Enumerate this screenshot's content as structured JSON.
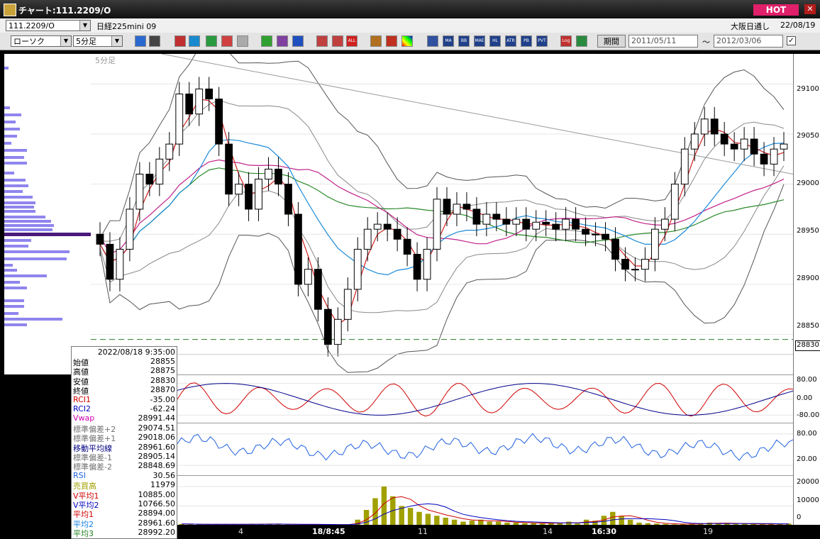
{
  "window": {
    "title": "チャート:111.2209/O",
    "hot_label": "HOT",
    "close_label": "✕"
  },
  "header": {
    "symbol": "111.2209/O",
    "name": "日経225mini 09",
    "market": "大阪日通し",
    "date": "22/08/19"
  },
  "toolbar": {
    "chart_type": "ローソク",
    "interval": "5分足",
    "period_button": "期間",
    "date_from": "2011/05/11",
    "date_to": "2012/03/06",
    "range_sep": "〜",
    "icons": [
      "zoom-icon",
      "cursor-icon",
      "draw-icon",
      "analyze-icon",
      "chart-icon",
      "trend-icon",
      "info-icon",
      "pen-icon",
      "arrow-icon",
      "return-icon",
      "split-icon",
      "gap-icon",
      "all-icon",
      "gear-icon",
      "tools-icon",
      "color-icon",
      "bars-icon",
      "ma-icon",
      "bb-icon",
      "mae-icon",
      "hl-icon",
      "atr-icon",
      "pb-icon",
      "pvt-icon",
      "log-icon",
      "exit-icon"
    ],
    "icon_texts": [
      "MA",
      "BB",
      "MAE",
      "HL",
      "ATR",
      "PB",
      "PVT",
      "Log",
      "ALL"
    ],
    "checkbox_mark": "✓"
  },
  "main_panel": {
    "interval_label": "5分足",
    "price_flag": "28830",
    "y_ticks": [
      "29100",
      "29050",
      "29000",
      "28950",
      "28900",
      "28850"
    ]
  },
  "sub_panels": {
    "rci_ticks": [
      "80.00",
      "0.00",
      "-80.00"
    ],
    "rsi_ticks": [
      "80.00",
      "20.00"
    ],
    "volume_ticks": [
      "20000",
      "10000",
      "0"
    ]
  },
  "x_axis": {
    "labels": [
      "4",
      "18/8:45",
      "11",
      "14",
      "16:30",
      "19"
    ]
  },
  "info": {
    "datetime": "2022/08/18 9:35:00",
    "rows": [
      {
        "k": "始値",
        "v": "28855",
        "c": "#000"
      },
      {
        "k": "高値",
        "v": "28875",
        "c": "#000"
      },
      {
        "k": "安値",
        "v": "28830",
        "c": "#000"
      },
      {
        "k": "終値",
        "v": "28870",
        "c": "#000"
      },
      {
        "k": "RCI1",
        "v": "-35.00",
        "c": "#d00000"
      },
      {
        "k": "RCI2",
        "v": "-62.24",
        "c": "#0000c0"
      },
      {
        "k": "Vwap",
        "v": "28991.44",
        "c": "#d000b0"
      },
      {
        "k": "標準偏差+2",
        "v": "29074.51",
        "c": "#707070"
      },
      {
        "k": "標準偏差+1",
        "v": "29018.06",
        "c": "#707070"
      },
      {
        "k": "移動平均線",
        "v": "28961.60",
        "c": "#000080"
      },
      {
        "k": "標準偏差-1",
        "v": "28905.14",
        "c": "#707070"
      },
      {
        "k": "標準偏差-2",
        "v": "28848.69",
        "c": "#707070"
      },
      {
        "k": "RSI",
        "v": "30.56",
        "c": "#2060e0"
      },
      {
        "k": "売買高",
        "v": "11979",
        "c": "#a0a000"
      },
      {
        "k": "V平均1",
        "v": "10885.00",
        "c": "#d00000"
      },
      {
        "k": "V平均2",
        "v": "10766.50",
        "c": "#0000c0"
      },
      {
        "k": "平均1",
        "v": "28894.00",
        "c": "#d00000"
      },
      {
        "k": "平均2",
        "v": "28961.60",
        "c": "#1080e0"
      },
      {
        "k": "平均3",
        "v": "28992.20",
        "c": "#208020"
      }
    ]
  },
  "chart_data": {
    "type": "candlestick",
    "interval": "5分足",
    "ylim": [
      28810,
      29130
    ],
    "y_ticks": [
      28850,
      28900,
      28950,
      29000,
      29050,
      29100
    ],
    "reference_lines": [
      28845
    ],
    "last_price": 28830,
    "close_series": [
      28940,
      28905,
      28935,
      28975,
      29010,
      29000,
      29025,
      29040,
      29090,
      29070,
      29095,
      29085,
      29040,
      28990,
      29000,
      28975,
      29005,
      29015,
      29000,
      28970,
      28900,
      28915,
      28875,
      28840,
      28865,
      28895,
      28935,
      28955,
      28960,
      28955,
      28945,
      28930,
      28905,
      28935,
      28985,
      28970,
      28980,
      28975,
      28960,
      28970,
      28965,
      28960,
      28965,
      28955,
      28962,
      28960,
      28955,
      28965,
      28955,
      28950,
      28950,
      28945,
      28925,
      28915,
      28915,
      28925,
      28955,
      28965,
      29000,
      29035,
      29050,
      29065,
      29050,
      29040,
      29035,
      29045,
      29030,
      29020,
      29035,
      29040
    ],
    "overlays": [
      "RCI1",
      "RCI2",
      "Vwap",
      "標準偏差+2",
      "標準偏差+1",
      "移動平均線",
      "標準偏差-1",
      "標準偏差-2",
      "平均1",
      "平均2",
      "平均3"
    ],
    "volume": [
      800,
      700,
      600,
      500,
      600,
      700,
      700,
      500,
      900,
      800,
      900,
      600,
      500,
      400,
      500,
      400,
      500,
      600,
      400,
      300,
      3000,
      8000,
      14000,
      20000,
      15000,
      10000,
      9000,
      7000,
      6000,
      5000,
      4000,
      3000,
      2000,
      2500,
      3000,
      2000,
      2000,
      1500,
      1500,
      1200,
      1200,
      1000,
      1500,
      1200,
      2000,
      1000,
      3000,
      2500,
      5000,
      7000,
      5000,
      3000,
      1500,
      1200,
      1000,
      800,
      600,
      700,
      900,
      1200,
      1500,
      1200,
      1000,
      800,
      900,
      800,
      700,
      900,
      800,
      1000
    ]
  }
}
